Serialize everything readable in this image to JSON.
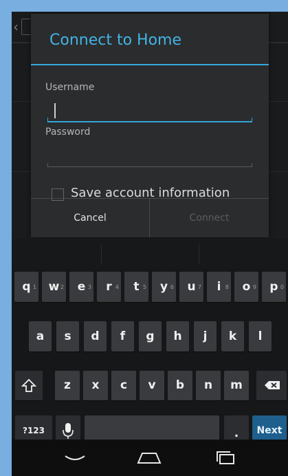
{
  "dialog": {
    "title": "Connect to Home",
    "username_label": "Username",
    "username_value": "",
    "password_label": "Password",
    "password_value": "",
    "save_label": "Save account information",
    "save_checked": false,
    "cancel_label": "Cancel",
    "connect_label": "Connect"
  },
  "keyboard": {
    "row1": [
      {
        "k": "q",
        "h": "1"
      },
      {
        "k": "w",
        "h": "2"
      },
      {
        "k": "e",
        "h": "3"
      },
      {
        "k": "r",
        "h": "4"
      },
      {
        "k": "t",
        "h": "5"
      },
      {
        "k": "y",
        "h": "6"
      },
      {
        "k": "u",
        "h": "7"
      },
      {
        "k": "i",
        "h": "8"
      },
      {
        "k": "o",
        "h": "9"
      },
      {
        "k": "p",
        "h": "0"
      }
    ],
    "row2": [
      "a",
      "s",
      "d",
      "f",
      "g",
      "h",
      "j",
      "k",
      "l"
    ],
    "row3": [
      "z",
      "x",
      "c",
      "v",
      "b",
      "n",
      "m"
    ],
    "symbols_label": "?123",
    "period_label": ".",
    "next_label": "Next"
  },
  "colors": {
    "accent": "#33a6da",
    "background": "#78aee0"
  },
  "icons": {
    "shift": "shift-icon",
    "backspace": "backspace-icon",
    "mic": "microphone-icon",
    "nav_back": "nav-back-icon",
    "nav_home": "nav-home-icon",
    "nav_recents": "nav-recents-icon"
  }
}
